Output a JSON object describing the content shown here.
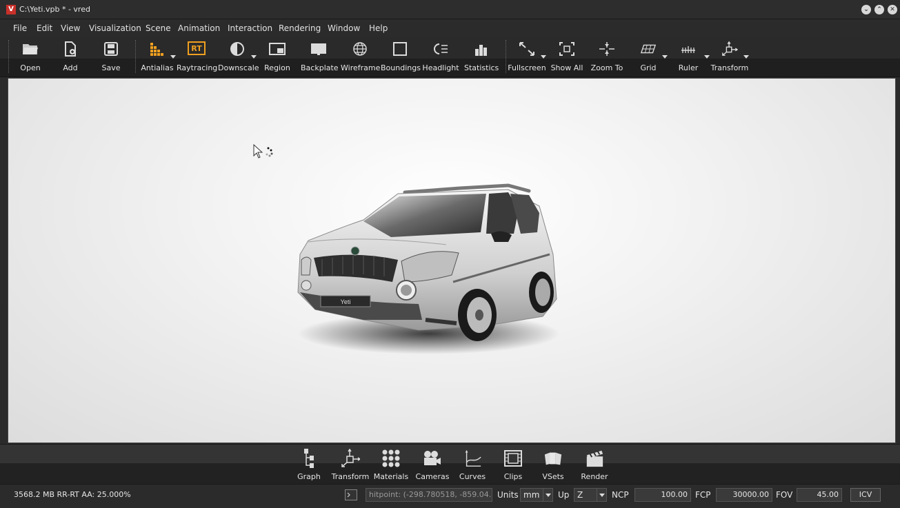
{
  "window": {
    "title": "C:\\Yeti.vpb * - vred",
    "logo": "V"
  },
  "menu": [
    "File",
    "Edit",
    "View",
    "Visualization",
    "Scene",
    "Animation",
    "Interaction",
    "Rendering",
    "Window",
    "Help"
  ],
  "toolbar": {
    "open": "Open",
    "add": "Add",
    "save": "Save",
    "antialias": "Antialias",
    "raytracing": "Raytracing",
    "raytracing_icon_text": "RT",
    "downscale": "Downscale",
    "region": "Region",
    "backplate": "Backplate",
    "wireframe": "Wireframe",
    "boundings": "Boundings",
    "headlight": "Headlight",
    "statistics": "Statistics",
    "fullscreen": "Fullscreen",
    "show_all": "Show All",
    "zoom_to": "Zoom To",
    "grid": "Grid",
    "ruler": "Ruler",
    "transform": "Transform"
  },
  "viewport": {
    "plate_text": "Yeti"
  },
  "dock": {
    "graph": "Graph",
    "transform": "Transform",
    "materials": "Materials",
    "cameras": "Cameras",
    "curves": "Curves",
    "clips": "Clips",
    "vsets": "VSets",
    "render": "Render"
  },
  "status": {
    "memory": "3568.2 MB  RR-RT AA: 25.000%",
    "hitpoint": "hitpoint: (-298.780518, -859.04...",
    "units_label": "Units",
    "units_value": "mm",
    "up_label": "Up",
    "up_value": "Z",
    "ncp_label": "NCP",
    "ncp_value": "100.00",
    "fcp_label": "FCP",
    "fcp_value": "30000.00",
    "fov_label": "FOV",
    "fov_value": "45.00",
    "icv": "ICV"
  },
  "colors": {
    "accent_orange": "#f0a020",
    "logo_red": "#c8302a"
  }
}
